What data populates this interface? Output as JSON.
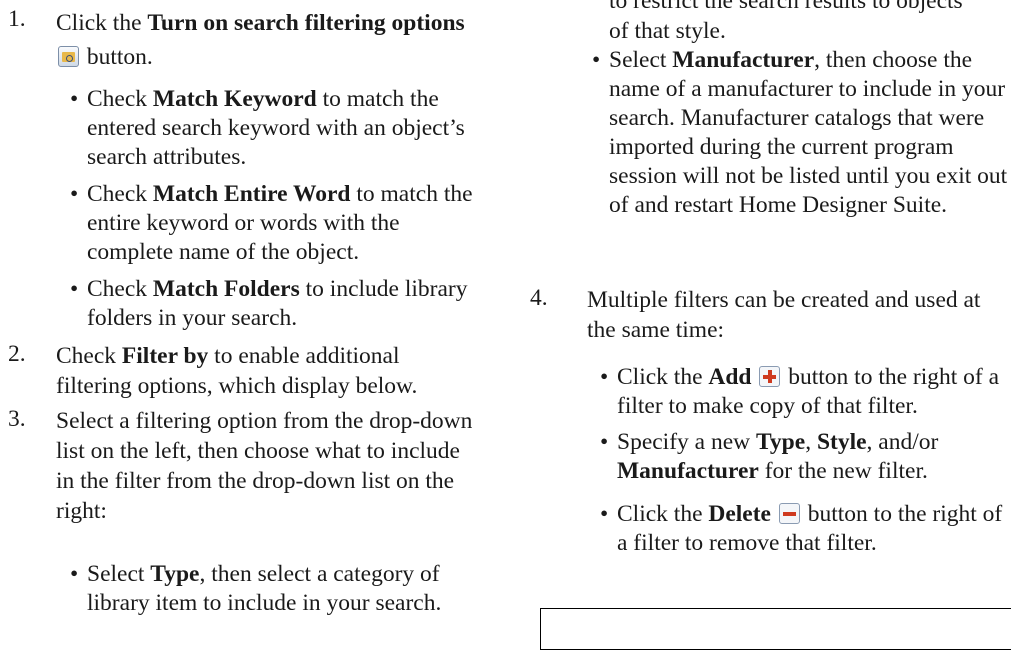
{
  "left": {
    "step1": {
      "num": "1.",
      "pre": "Click the ",
      "bold": "Turn on search filtering options",
      "post": " button.",
      "icon": "search-filter-icon",
      "bullets": [
        {
          "pre": "Check ",
          "bold": "Match Keyword",
          "post": " to match the entered search keyword with an object’s search attributes."
        },
        {
          "pre": "Check ",
          "bold": "Match Entire Word",
          "post": " to match the entire keyword or words with the complete name of the object."
        },
        {
          "pre": "Check ",
          "bold": "Match Folders",
          "post": " to include library folders in your search."
        }
      ]
    },
    "step2": {
      "num": "2.",
      "pre": "Check ",
      "bold": "Filter by",
      "post": " to enable additional filtering options, which display below."
    },
    "step3": {
      "num": "3.",
      "text": "Select a filtering option from the drop-down list on the left, then choose what to include in the filter from the drop-down list on the right:",
      "bullets": [
        {
          "pre": "Select ",
          "bold": "Type",
          "post": ", then select a category of library item to include in your search."
        }
      ]
    }
  },
  "right": {
    "cont": {
      "text1": "to restrict the search results to objects",
      "text2": "of that style."
    },
    "manufacturer": {
      "pre": "Select ",
      "bold": "Manufacturer",
      "post": ", then choose the name of a manufacturer to include in your search. Manufacturer catalogs that were imported during the current program session will not be listed until you exit out of and restart Home Designer Suite."
    },
    "step4": {
      "num": "4.",
      "text": "Multiple filters can be created and used at the same time:",
      "b1": {
        "pre": "Click the ",
        "bold": "Add",
        "post": " button to the right of a filter to make copy of that filter.",
        "icon": "add-plus-icon"
      },
      "b2": {
        "pre": "Specify a new ",
        "bold1": "Type",
        "mid1": ", ",
        "bold2": "Style",
        "mid2": ", and/or ",
        "bold3": "Manufacturer",
        "post": " for the new filter."
      },
      "b3": {
        "pre": "Click the ",
        "bold": "Delete",
        "post": " button to the right of a filter to remove that filter.",
        "icon": "delete-minus-icon"
      }
    }
  }
}
